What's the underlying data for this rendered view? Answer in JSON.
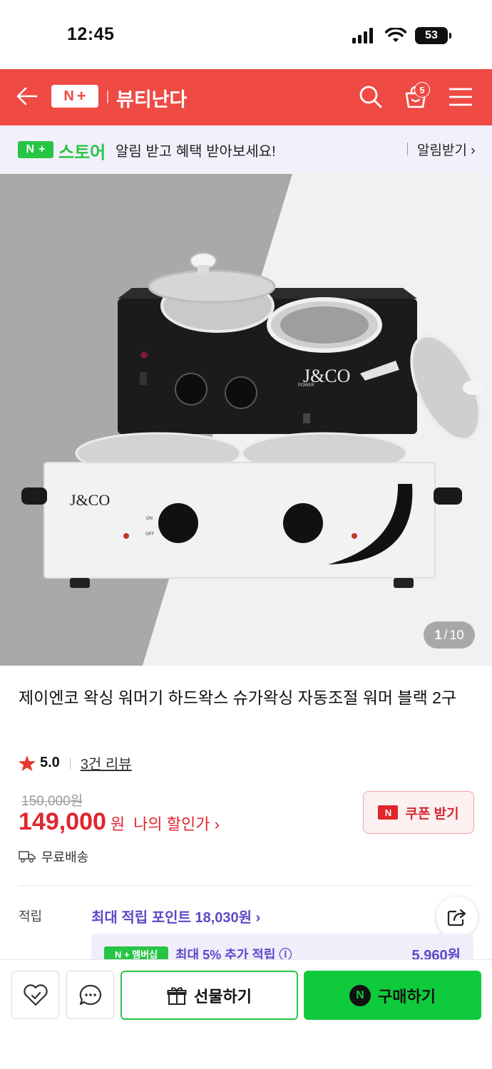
{
  "status_bar": {
    "time": "12:45",
    "battery": "53"
  },
  "header": {
    "logo_n": "N",
    "logo_plus": "+",
    "store_name": "뷰티난다",
    "cart_count": "5"
  },
  "notice": {
    "logo_n": "N",
    "logo_plus": "+",
    "store_label": "스토어",
    "message": "알림 받고 혜택 받아보세요!",
    "link": "알림받기 ›"
  },
  "hero": {
    "page_current": "1",
    "page_total": "10",
    "brand_on_device": "J&CO",
    "device_labels": {
      "power": "POWER",
      "on": "ON",
      "off": "OFF"
    }
  },
  "product": {
    "title": "제이엔코 왁싱 워머기 하드왁스 슈가왁싱 자동조절 워머 블랙 2구",
    "rating": "5.0",
    "reviews": "3건 리뷰",
    "original_price": "150,000원",
    "price": "149,000",
    "won": "원",
    "my_discount": "나의 할인가 ›",
    "coupon_label": "쿠폰 받기",
    "coupon_icon": "N",
    "shipping": "무료배송",
    "points_label": "적립",
    "points_value": "최대 적립 포인트 18,030원 ›",
    "membership_badge": "N + 멤버십",
    "membership_text": "최대 5% 추가 적립 ⓘ",
    "membership_amount": "5,960원"
  },
  "bottom": {
    "gift_label": "선물하기",
    "buy_label": "구매하기",
    "buy_icon": "N"
  },
  "colors": {
    "header_red": "#ef4a44",
    "naver_green": "#26c545",
    "buy_green": "#0fcb3c",
    "price_red": "#e0252c",
    "purple": "#5c49c9"
  }
}
